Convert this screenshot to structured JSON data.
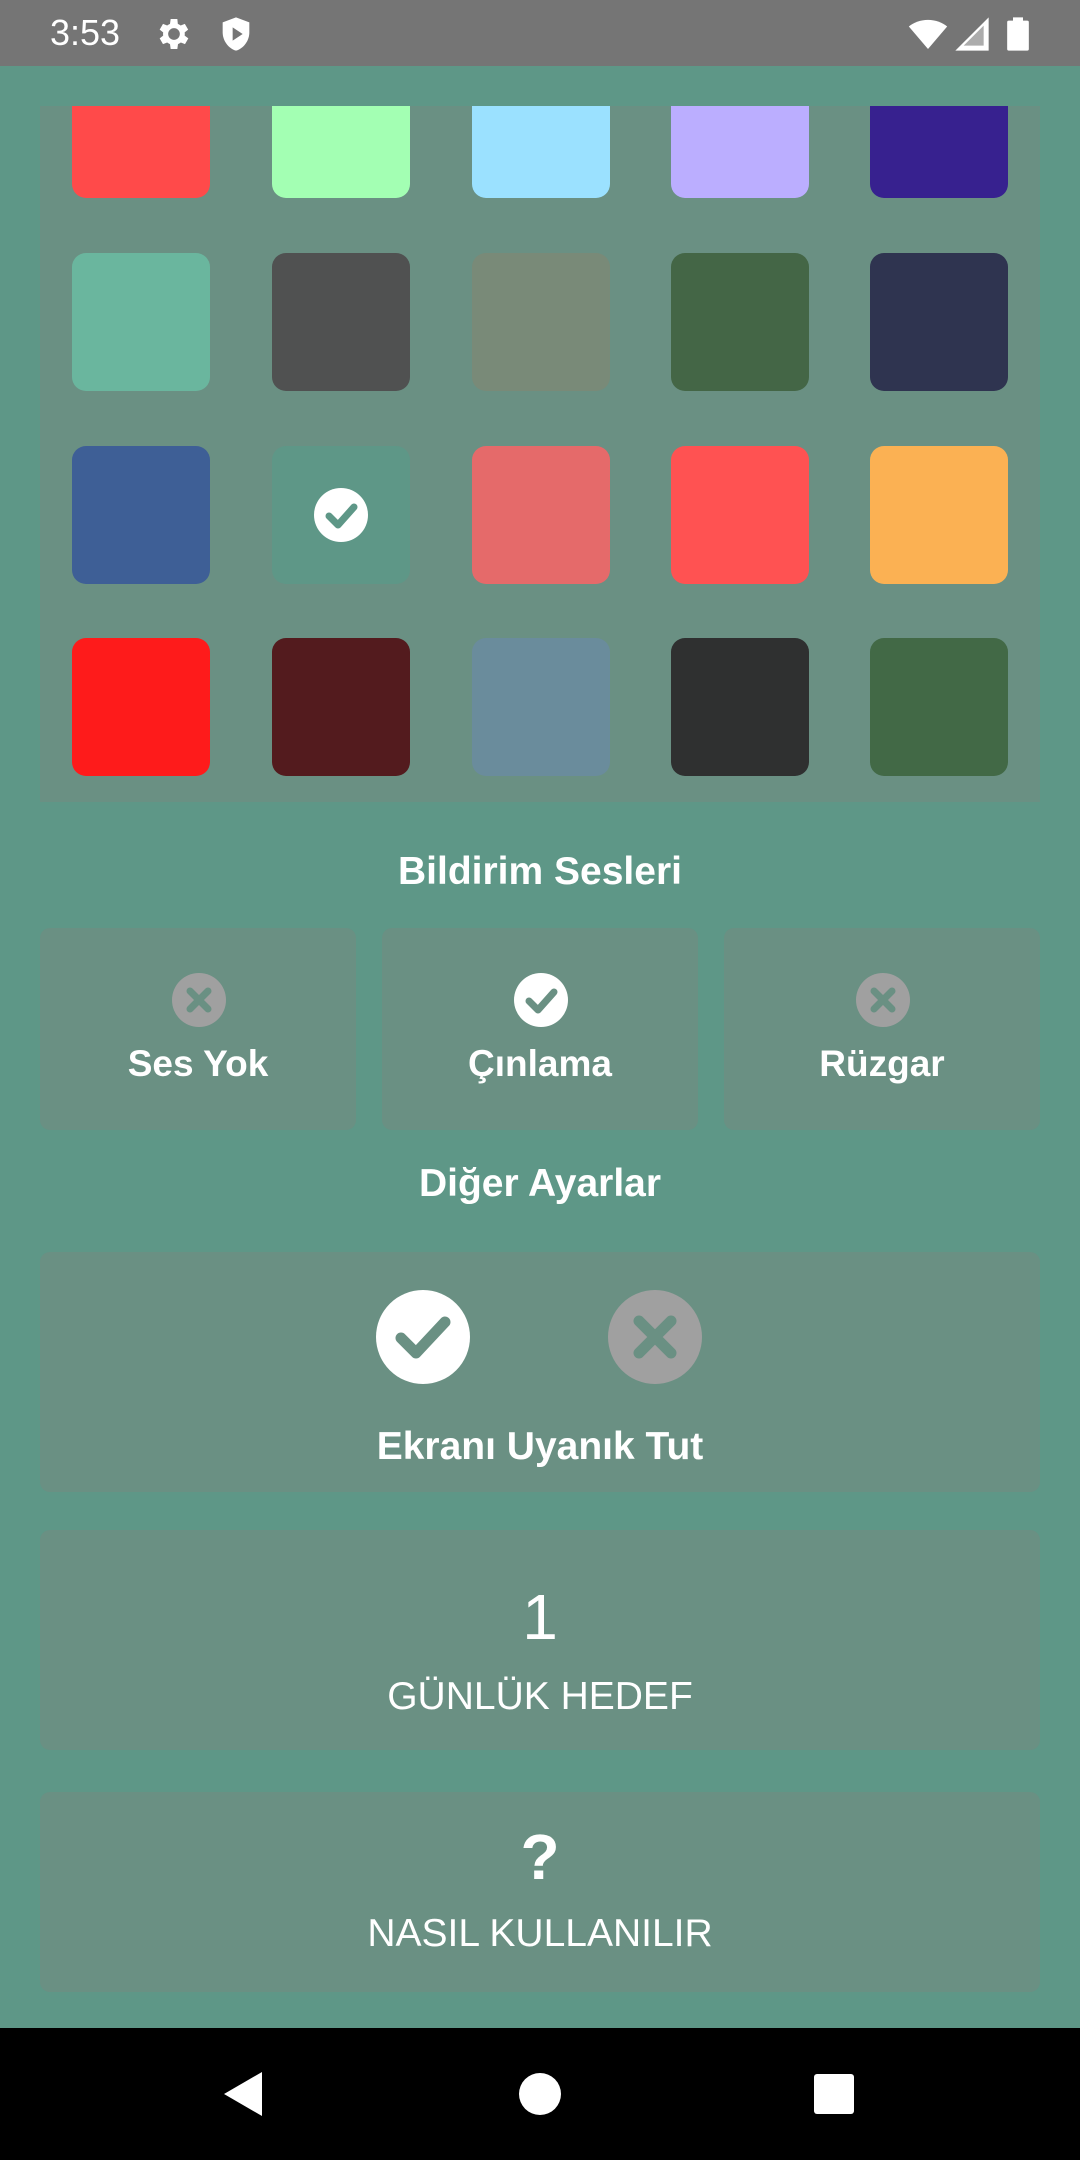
{
  "status_bar": {
    "time": "3:53",
    "left_icons": [
      "gear-icon",
      "shield-play-icon"
    ],
    "right_icons": [
      "wifi-icon",
      "signal-icon",
      "battery-icon"
    ]
  },
  "colors": {
    "selected_index": 11,
    "swatches": [
      "#ff4a4a",
      "#a3ffb3",
      "#9be1ff",
      "#bbaeff",
      "#37218f",
      "#6ab69e",
      "#505151",
      "#798a78",
      "#446646",
      "#2f3450",
      "#3e5f96",
      "#5e9787",
      "#e56a6a",
      "#ff5252",
      "#fbb153",
      "#fe1b1b",
      "#531b1e",
      "#6a8c9c",
      "#2f3030",
      "#426946"
    ]
  },
  "sounds": {
    "title": "Bildirim Sesleri",
    "options": [
      {
        "label": "Ses Yok",
        "selected": false
      },
      {
        "label": "Çınlama",
        "selected": true
      },
      {
        "label": "Rüzgar",
        "selected": false
      }
    ]
  },
  "other": {
    "title": "Diğer Ayarlar",
    "keep_awake_label": "Ekranı Uyanık Tut",
    "keep_awake_enabled": true
  },
  "goal": {
    "value": "1",
    "label": "GÜNLÜK HEDEF"
  },
  "help": {
    "icon": "?",
    "label": "NASIL KULLANILIR"
  },
  "nav": [
    "back-icon",
    "home-icon",
    "recents-icon"
  ]
}
